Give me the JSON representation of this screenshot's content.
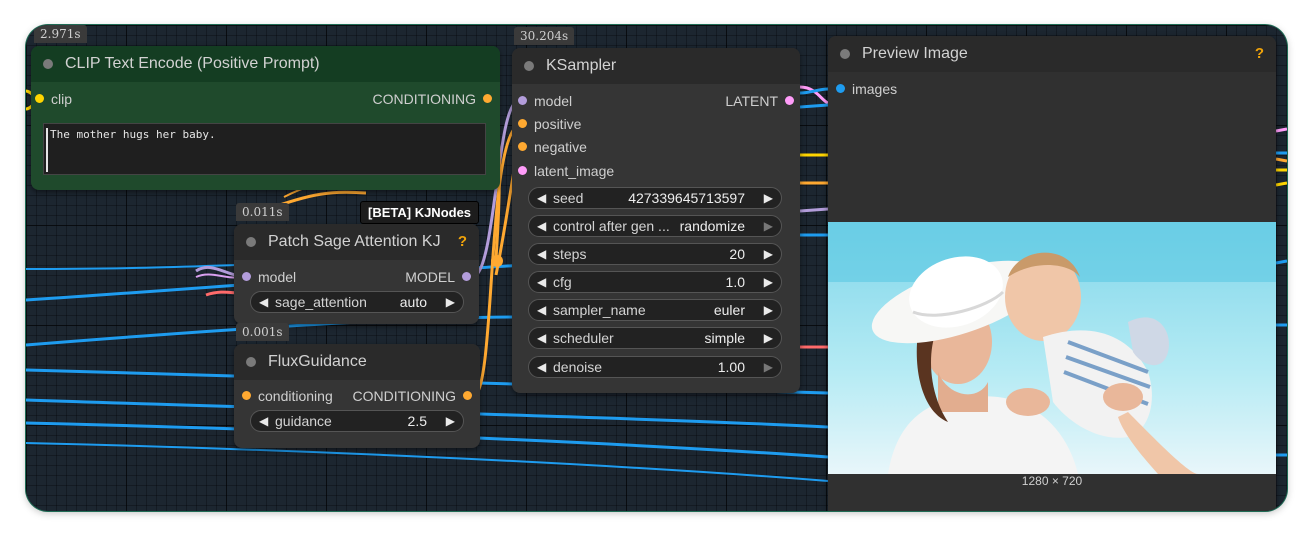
{
  "clip_node": {
    "title": "CLIP Text Encode (Positive Prompt)",
    "timing": "2.971s",
    "input": "clip",
    "output": "CONDITIONING",
    "prompt_text": "The mother hugs her baby."
  },
  "patch_node": {
    "title": "Patch Sage Attention KJ",
    "timing": "0.011s",
    "help": "?",
    "tooltip": "[BETA] KJNodes",
    "input": "model",
    "output": "MODEL",
    "widget": {
      "name": "sage_attention",
      "value": "auto"
    }
  },
  "flux_node": {
    "title": "FluxGuidance",
    "timing": "0.001s",
    "input": "conditioning",
    "output": "CONDITIONING",
    "widget": {
      "name": "guidance",
      "value": "2.5"
    }
  },
  "ksampler_node": {
    "title": "KSampler",
    "timing": "30.204s",
    "inputs": [
      "model",
      "positive",
      "negative",
      "latent_image"
    ],
    "output": "LATENT",
    "widgets": [
      {
        "name": "seed",
        "value": "427339645713597"
      },
      {
        "name": "control after gen ...",
        "value": "randomize"
      },
      {
        "name": "steps",
        "value": "20"
      },
      {
        "name": "cfg",
        "value": "1.0"
      },
      {
        "name": "sampler_name",
        "value": "euler"
      },
      {
        "name": "scheduler",
        "value": "simple"
      },
      {
        "name": "denoise",
        "value": "1.00"
      }
    ]
  },
  "preview_node": {
    "title": "Preview Image",
    "help": "?",
    "input": "images",
    "image_dims": "1280 × 720"
  },
  "colors": {
    "canvas": "#1c2630",
    "node_body": "#353535",
    "clip_green": "#1f4a2c",
    "clip_yellow": "#ffd500",
    "conditioning_orange": "#ffa931",
    "model_lavender": "#b39ddb",
    "latent_pink": "#ff9cf9",
    "image_blue": "#64b5f6",
    "wire_blue": "#1e9cf0"
  },
  "icons": {
    "arrow_left": "◀",
    "arrow_right": "▶"
  }
}
